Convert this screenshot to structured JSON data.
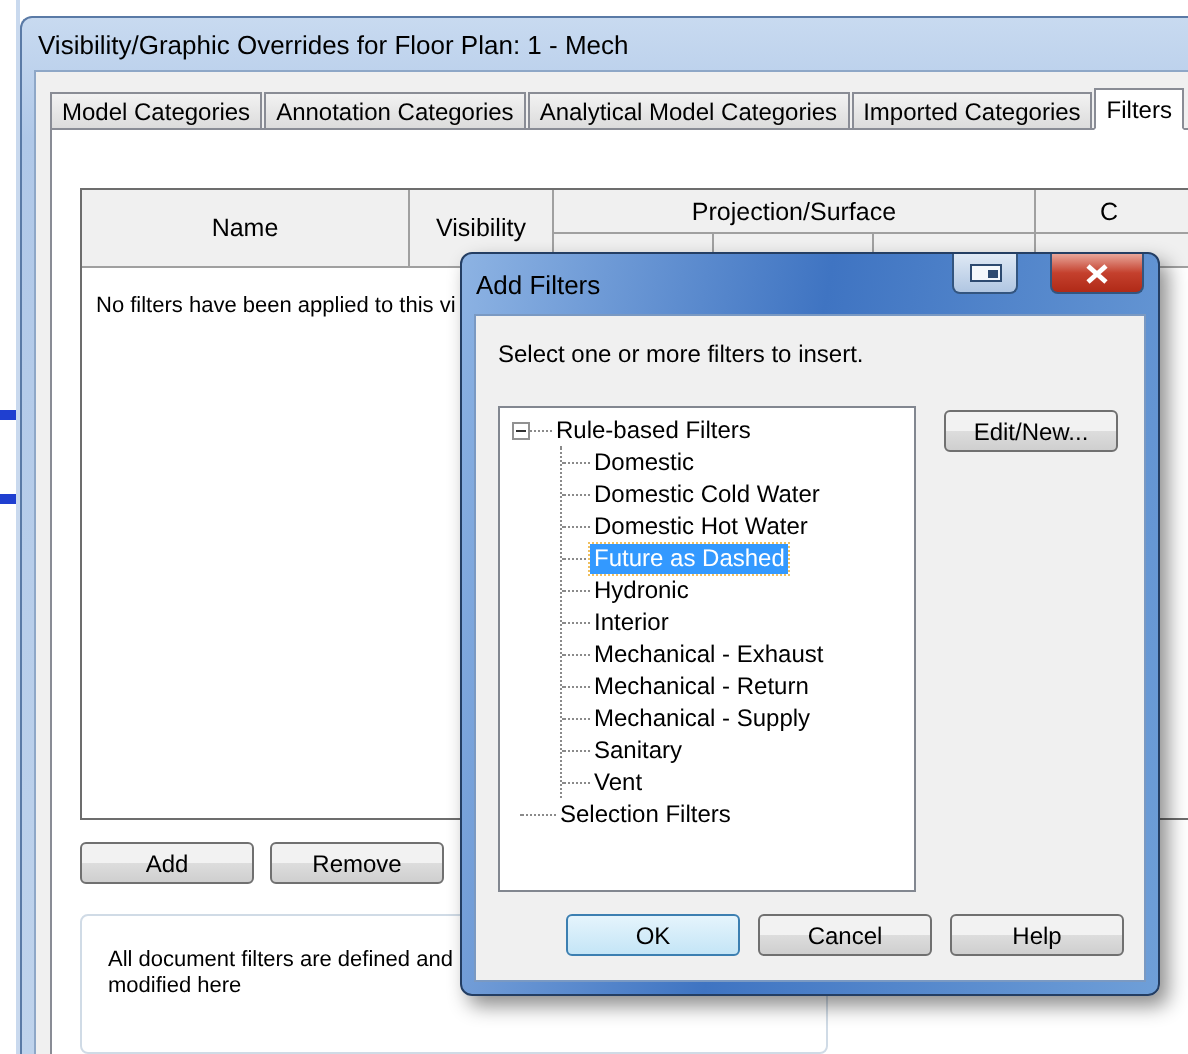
{
  "window": {
    "title": "Visibility/Graphic Overrides for Floor Plan: 1 - Mech"
  },
  "tabs": [
    {
      "label": "Model Categories",
      "selected": false
    },
    {
      "label": "Annotation Categories",
      "selected": false
    },
    {
      "label": "Analytical Model Categories",
      "selected": false
    },
    {
      "label": "Imported Categories",
      "selected": false
    },
    {
      "label": "Filters",
      "selected": true
    }
  ],
  "table": {
    "columns": [
      {
        "label": "Name"
      },
      {
        "label": "Visibility"
      }
    ],
    "groups": [
      {
        "label": "Projection/Surface"
      },
      {
        "label": "C"
      }
    ],
    "empty_message": "No filters have been applied to this vi"
  },
  "buttons": [
    "Add",
    "Remove"
  ],
  "info": {
    "lines": [
      "All document filters are defined and",
      "modified here"
    ]
  },
  "dialog": {
    "title": "Add Filters",
    "prompt": "Select one or more filters to insert.",
    "tree": [
      {
        "label": "Rule-based Filters",
        "expanded": true,
        "selected": false,
        "children": [
          {
            "label": "Domestic",
            "selected": false
          },
          {
            "label": "Domestic Cold Water",
            "selected": false
          },
          {
            "label": "Domestic Hot Water",
            "selected": false
          },
          {
            "label": "Future as Dashed",
            "selected": true
          },
          {
            "label": "Hydronic",
            "selected": false
          },
          {
            "label": "Interior",
            "selected": false
          },
          {
            "label": "Mechanical - Exhaust",
            "selected": false
          },
          {
            "label": "Mechanical - Return",
            "selected": false
          },
          {
            "label": "Mechanical - Supply",
            "selected": false
          },
          {
            "label": "Sanitary",
            "selected": false
          },
          {
            "label": "Vent",
            "selected": false
          }
        ]
      },
      {
        "label": "Selection Filters",
        "selected": false
      }
    ],
    "side_button": "Edit/New...",
    "buttons": [
      {
        "label": "OK",
        "default": true
      },
      {
        "label": "Cancel",
        "default": false
      },
      {
        "label": "Help",
        "default": false
      }
    ]
  }
}
